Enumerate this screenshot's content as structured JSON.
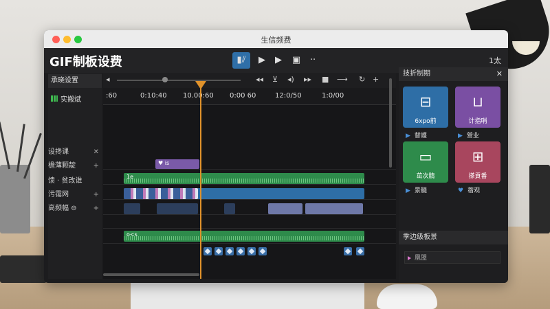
{
  "window": {
    "title": "生信频费"
  },
  "app": {
    "title": "GIF制板设费",
    "right_label": "1太"
  },
  "toolbar": [
    {
      "name": "edit-tool-button",
      "glyph": "▮⫽",
      "active": true
    },
    {
      "name": "play-button",
      "glyph": "▶"
    },
    {
      "name": "step-forward-button",
      "glyph": "▶"
    },
    {
      "name": "export-button",
      "glyph": "▣"
    },
    {
      "name": "more-button",
      "glyph": "··"
    }
  ],
  "left_panel": {
    "header": "承晓设置",
    "item": "实搬斌",
    "tracks": [
      {
        "label": "设搀课",
        "icon": "✕"
      },
      {
        "label": "檐薄颗靛",
        "icon": "+"
      },
      {
        "label": "馈 · 贫改谁",
        "icon": ""
      },
      {
        "label": "污霭网",
        "icon": "+"
      },
      {
        "label": "高频幅 ⊖",
        "icon": "+"
      }
    ]
  },
  "timeline": {
    "ticks": [
      ":60",
      "0:10:40",
      "10.00:60",
      "0:00 60",
      "12:0/50",
      "1:0/00"
    ],
    "clips": {
      "title_clip": "♥ is",
      "audio_label": "1e",
      "audio2_label": "o<s"
    }
  },
  "right_panel": {
    "header": "技折制期",
    "tiles": [
      {
        "label": "6xpo前",
        "sub": "替護",
        "color": "#2e6ea6",
        "icon": "briefcase-icon"
      },
      {
        "label": "计指哨",
        "sub": "營业",
        "color": "#7a4fa3",
        "icon": "download-icon"
      },
      {
        "label": "茁次腈",
        "sub": "景髓",
        "color": "#2e8b4b",
        "icon": "monitor-icon"
      },
      {
        "label": "搽貢番",
        "sub": "蓿观",
        "color": "#a8465e",
        "icon": "split-icon"
      }
    ],
    "section": "季边级板景",
    "field_placeholder": "凰盟"
  }
}
